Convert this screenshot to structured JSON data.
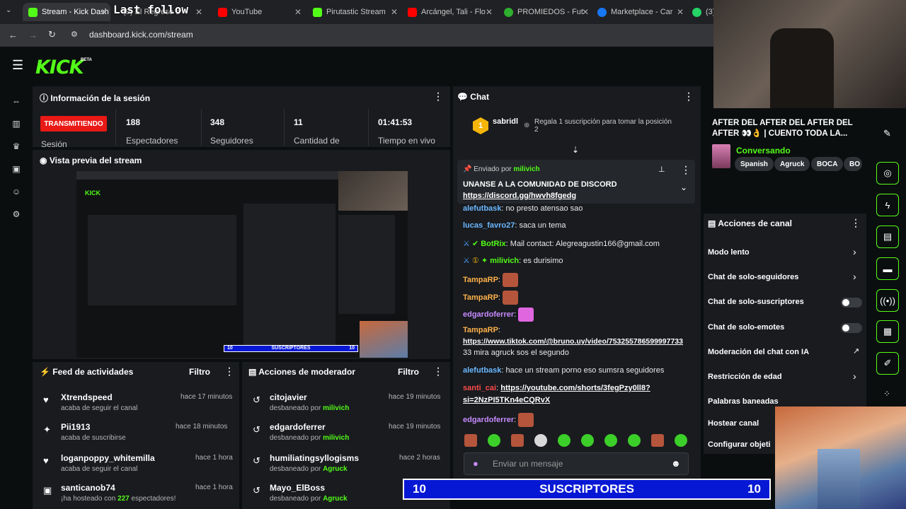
{
  "browser": {
    "tabs": [
      {
        "label": "Stream - Kick Dash",
        "color": "#53fc18"
      },
      {
        "label": "(9) El Regreso d",
        "color": "#888888"
      },
      {
        "label": "YouTube",
        "color": "#ff0000"
      },
      {
        "label": "Pirutastic Stream",
        "color": "#53fc18"
      },
      {
        "label": "Arcángel, Tali - Flo",
        "color": "#ff0000"
      },
      {
        "label": "PROMIEDOS - Fut",
        "color": "#2fae2f"
      },
      {
        "label": "Marketplace - Car",
        "color": "#1877f2"
      },
      {
        "label": "(3)",
        "color": "#25d366"
      }
    ],
    "url": "dashboard.kick.com/stream",
    "overlay_title": "Last follow"
  },
  "brand": {
    "logo": "KICK",
    "beta": "BETA"
  },
  "session": {
    "title": "Información de la sesión",
    "status": "TRANSMITIENDO",
    "status_sub": "Sesión",
    "stats": [
      {
        "value": "188",
        "label": "Espectadores"
      },
      {
        "value": "348",
        "label": "Seguidores"
      },
      {
        "value": "11",
        "label": "Cantidad de"
      },
      {
        "value": "01:41:53",
        "label": "Tiempo en vivo"
      }
    ]
  },
  "preview": {
    "title": "Vista previa del stream"
  },
  "feed": {
    "title": "Feed de actividades",
    "filter": "Filtro",
    "items": [
      {
        "name": "Xtrendspeed",
        "sub": "acaba de seguir el canal",
        "time": "hace 17 minutos",
        "icon": "♥"
      },
      {
        "name": "Pii1913",
        "sub": "acaba de suscribirse",
        "time": "hace 18 minutos",
        "icon": "✦"
      },
      {
        "name": "loganpoppy_whitemilla",
        "sub": "acaba de seguir el canal",
        "time": "hace 1 hora",
        "icon": "♥"
      },
      {
        "name": "santicanob74",
        "sub_pre": "¡ha hosteado con ",
        "sub_num": "227",
        "sub_post": " espectadores!",
        "time": "hace 1 hora",
        "icon": "▣"
      }
    ]
  },
  "mod": {
    "title": "Acciones de moderador",
    "filter": "Filtro",
    "items": [
      {
        "name": "citojavier",
        "sub": "desbaneado por",
        "by": "milivich",
        "time": "hace 19 minutos"
      },
      {
        "name": "edgardoferrer",
        "sub": "desbaneado por",
        "by": "milivich",
        "time": "hace 19 minutos"
      },
      {
        "name": "humiliatingsyllogisms",
        "sub": "desbaneado por",
        "by": "Agruck",
        "time": "hace 2 horas"
      },
      {
        "name": "Mayo_ElBoss",
        "sub": "desbaneado por",
        "by": "Agruck",
        "time": ""
      }
    ]
  },
  "chat": {
    "title": "Chat",
    "top_user": "sabridl",
    "top_rank": "1",
    "gift_text": "Regala 1 suscripción para tomar la posición 2",
    "pinned_by": "Enviado por",
    "pinned_user": "milivich",
    "pinned_text": "UNANSE A LA COMUNIDAD DE DISCORD",
    "pinned_link": "https://discord.gg/hwvh8fgedg",
    "messages": [
      {
        "user": "alefutbask",
        "text": "no presto atensao sao",
        "cls": "u-blue"
      },
      {
        "user": "lucas_favro27",
        "text": "saca un tema",
        "cls": "u-blue"
      },
      {
        "user": "BotRix",
        "text": "Mail contact: Alegreagustin166@gmail.com",
        "cls": "u-green"
      },
      {
        "user": "milivich",
        "text": "es durisimo",
        "cls": "u-green"
      },
      {
        "user": "TampaRP",
        "text": "",
        "cls": "u-orange"
      },
      {
        "user": "TampaRP",
        "text": "",
        "cls": "u-orange"
      },
      {
        "user": "edgardoferrer",
        "text": "",
        "cls": "u-purple"
      },
      {
        "user": "TampaRP",
        "text": "",
        "cls": "u-orange"
      },
      {
        "user": "",
        "text": "https://www.tiktok.com/@bruno.uy/video/753255786599997733",
        "cls": "link"
      },
      {
        "user": "",
        "text": "33 mira agruck sos el segundo",
        "cls": ""
      },
      {
        "user": "alefutbask",
        "text": "hace un stream porno eso sumsra seguidores",
        "cls": "u-blue"
      },
      {
        "user": "santi_cai",
        "text": "https://youtube.com/shorts/3fegPzy0ll8?",
        "cls": "u-red"
      },
      {
        "user": "",
        "text": "si=2NzPI5TKn4eCQRvX",
        "cls": "link"
      },
      {
        "user": "edgardoferrer",
        "text": "",
        "cls": "u-purple"
      }
    ],
    "input_placeholder": "Enviar un mensaje"
  },
  "stream_info": {
    "title": "AFTER DEL AFTER DEL AFTER DEL AFTER 👀👌 | CUENTO TODA LA...",
    "category": "Conversando",
    "tags": [
      "Spanish",
      "Agruck",
      "BOCA",
      "BO"
    ]
  },
  "channel_actions": {
    "title": "Acciones de canal",
    "items": [
      {
        "label": "Modo lento",
        "kind": "chevron"
      },
      {
        "label": "Chat de solo-seguidores",
        "kind": "chevron"
      },
      {
        "label": "Chat de solo-suscriptores",
        "kind": "toggle"
      },
      {
        "label": "Chat de solo-emotes",
        "kind": "toggle"
      },
      {
        "label": "Moderación del chat con IA",
        "kind": "external"
      },
      {
        "label": "Restricción de edad",
        "kind": "chevron"
      },
      {
        "label": "Palabras baneadas",
        "kind": "chevron"
      },
      {
        "label": "Hostear canal",
        "kind": ""
      },
      {
        "label": "Configurar objeti",
        "kind": ""
      }
    ]
  },
  "sub_overlay": {
    "left": "10",
    "label": "SUSCRIPTORES",
    "right": "10"
  },
  "preview_overlay": {
    "left": "10",
    "label": "SUSCRIPTORES",
    "right": "10"
  }
}
